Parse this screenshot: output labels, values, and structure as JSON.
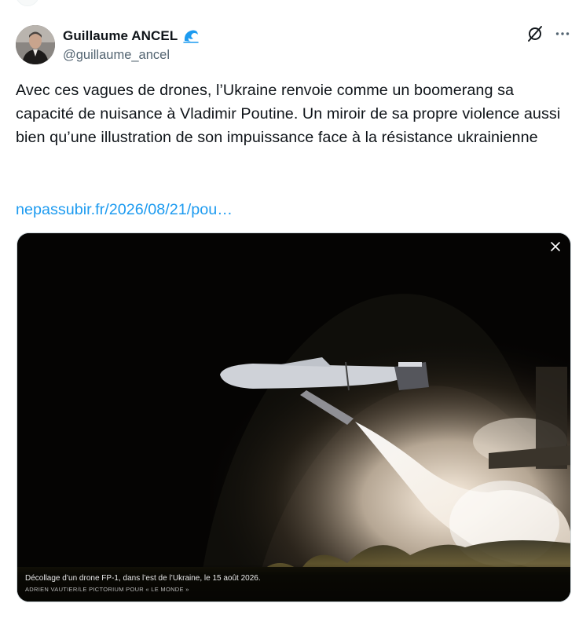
{
  "author": {
    "display_name": "Guillaume ANCEL",
    "handle": "@guillaume_ancel",
    "badge_icon": "wave-icon"
  },
  "header_actions": {
    "grok_icon": "grok-icon",
    "more_icon": "more-icon"
  },
  "tweet": {
    "text": "Avec ces vagues de drones, l’Ukraine renvoie comme un boomerang sa capacité de nuisance à Vladimir Poutine. Un miroir de sa propre violence aussi bien qu’une illustration de son impuissance face à la résistance ukrainienne",
    "link_text": "nepassubir.fr/2026/08/21/pou…"
  },
  "media": {
    "close_icon": "close-icon",
    "caption": "Décollage d’un drone FP-1, dans l’est de l’Ukraine, le 15 août 2026.",
    "credit": "ADRIEN VAUTIER/LE PICTORIUM POUR « LE MONDE »"
  },
  "colors": {
    "text": "#0f1419",
    "secondary": "#536471",
    "link": "#1d9bf0",
    "badge": "#1d9bf0"
  }
}
